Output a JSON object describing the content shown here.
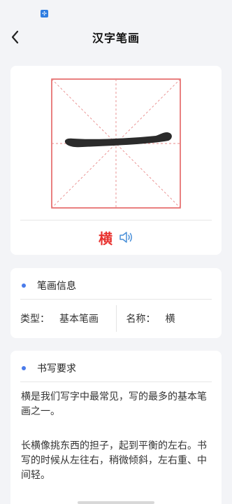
{
  "status_bar": {
    "notification_icon": "app-notification-icon"
  },
  "nav": {
    "title": "汉字笔画",
    "back_icon": "chevron-left-icon"
  },
  "stroke_card": {
    "character": "横",
    "audio_icon": "speaker-icon",
    "accent_color": "#e8322f",
    "stroke_color": "#2b2b2b"
  },
  "info_card": {
    "title": "笔画信息",
    "type_label": "类型：",
    "type_value": "基本笔画",
    "name_label": "名称：",
    "name_value": "横"
  },
  "requirement_card": {
    "title": "书写要求",
    "paragraph_1": "横是我们写字中最常见，写的最多的基本笔画之一。",
    "paragraph_2": "长横像挑东西的担子，起到平衡的左右。书写的时候从左往右，稍微倾斜，左右重、中间轻。"
  },
  "colors": {
    "bullet": "#4a7bea",
    "background": "#f3f4f7"
  }
}
